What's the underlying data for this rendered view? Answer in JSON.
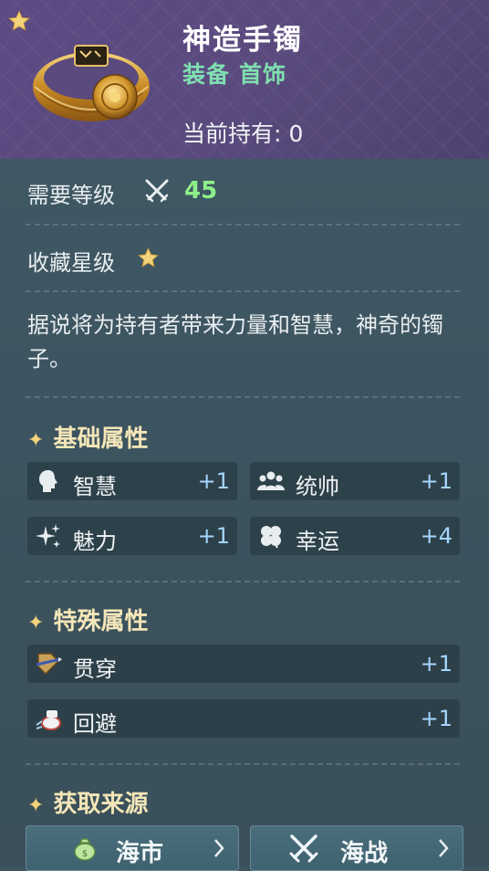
{
  "item": {
    "name": "神造手镯",
    "category_1": "装备",
    "category_2": "首饰",
    "owned_label": "当前持有:",
    "owned_count": "0",
    "rarity_stars": 1
  },
  "requirements": {
    "level_label": "需要等级",
    "level_value": "45",
    "collection_label": "收藏星级",
    "collection_stars": 1
  },
  "description": "据说将为持有者带来力量和智慧，神奇的镯子。",
  "base_attributes": {
    "title": "基础属性",
    "items": [
      {
        "name": "智慧",
        "value": "+1",
        "icon": "wisdom-head-icon"
      },
      {
        "name": "统帅",
        "value": "+1",
        "icon": "leadership-group-icon"
      },
      {
        "name": "魅力",
        "value": "+1",
        "icon": "charm-sparkle-icon"
      },
      {
        "name": "幸运",
        "value": "+4",
        "icon": "luck-clover-icon"
      }
    ]
  },
  "special_attributes": {
    "title": "特殊属性",
    "items": [
      {
        "name": "贯穿",
        "value": "+1",
        "icon": "pierce-icon"
      },
      {
        "name": "回避",
        "value": "+1",
        "icon": "evade-icon"
      }
    ]
  },
  "sources": {
    "title": "获取来源",
    "items": [
      {
        "label": "海市",
        "icon": "money-bag-icon"
      },
      {
        "label": "海战",
        "icon": "crossed-swords-icon"
      }
    ]
  },
  "colors": {
    "header_bg": "#5a4a7e",
    "level_value": "#8ef08a",
    "category_text": "#7fe0b0",
    "stat_value": "#a6d6ff",
    "star": "#f2d27a"
  }
}
